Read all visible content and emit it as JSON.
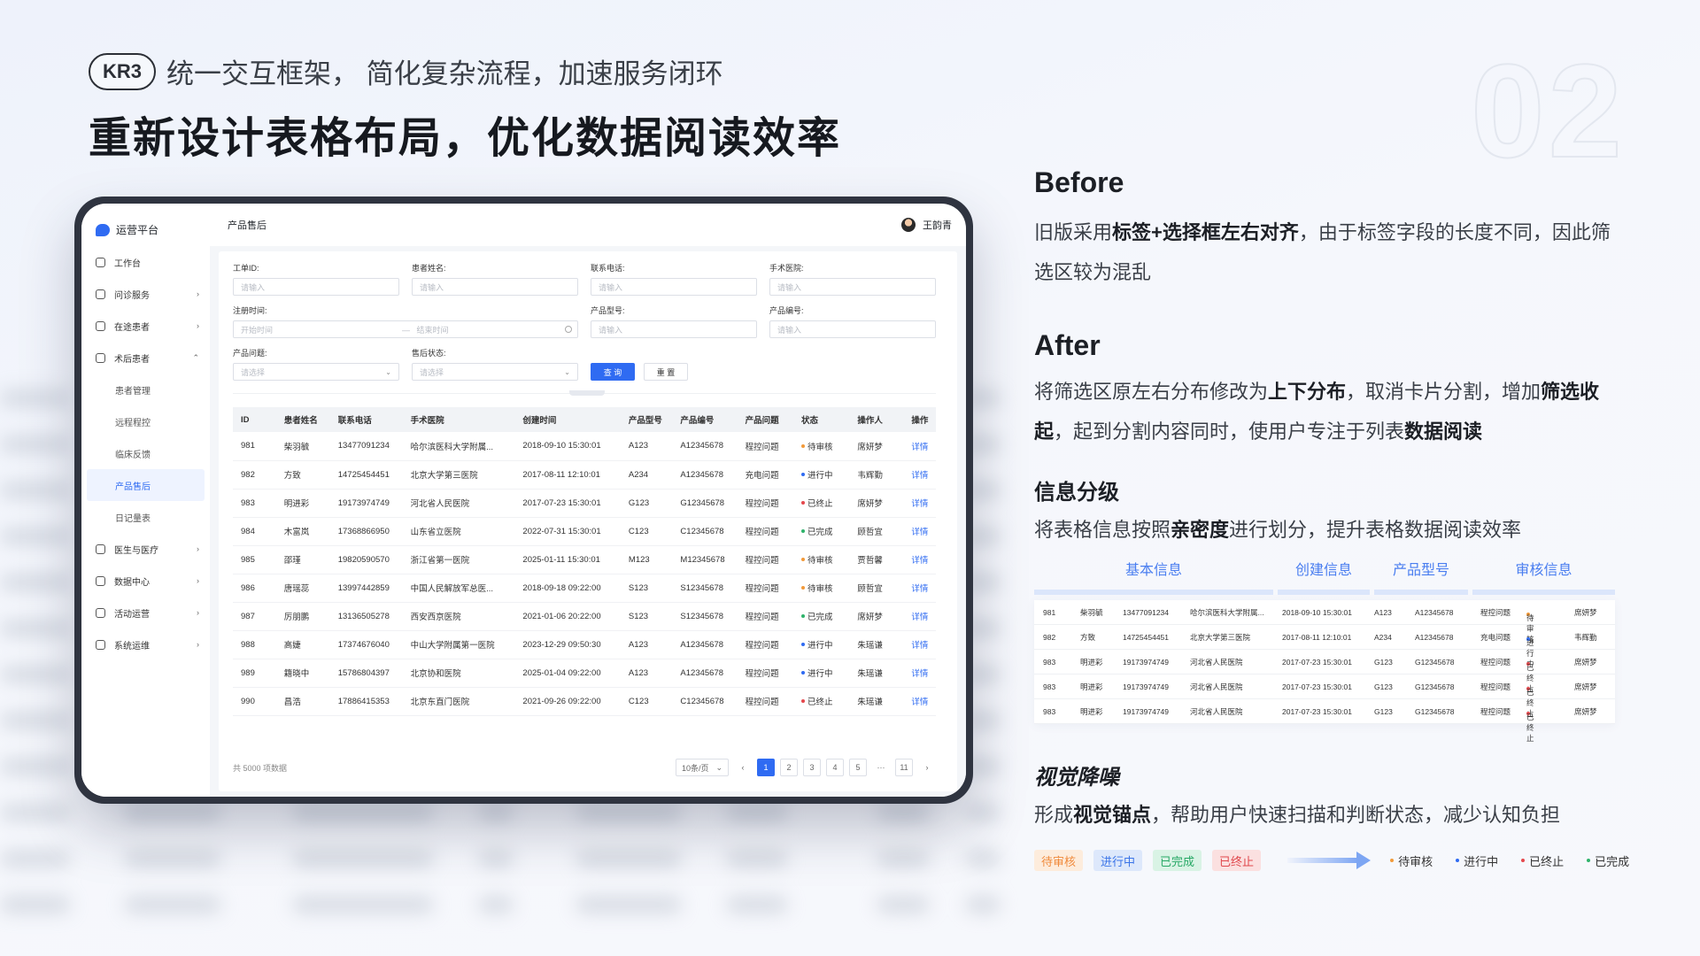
{
  "header": {
    "kr_badge": "KR3",
    "kr_text": "统一交互框架， 简化复杂流程，加速服务闭环",
    "title": "重新设计表格布局，优化数据阅读效率",
    "big_number": "02"
  },
  "app": {
    "logo_text": "运营平台",
    "page_title": "产品售后",
    "user_name": "王韵青",
    "nav": [
      {
        "label": "工作台",
        "icon": "home-icon",
        "arrow": ""
      },
      {
        "label": "问诊服务",
        "icon": "stethoscope-icon",
        "arrow": "›"
      },
      {
        "label": "在途患者",
        "icon": "user-icon",
        "arrow": "›"
      },
      {
        "label": "术后患者",
        "icon": "clipboard-icon",
        "arrow": "⌃"
      }
    ],
    "subnav": [
      "患者管理",
      "远程程控",
      "临床反馈",
      "产品售后",
      "日记量表"
    ],
    "nav_bottom": [
      {
        "label": "医生与医疗",
        "icon": "doctor-icon",
        "arrow": "›"
      },
      {
        "label": "数据中心",
        "icon": "data-icon",
        "arrow": "›"
      },
      {
        "label": "活动运营",
        "icon": "activity-icon",
        "arrow": "›"
      },
      {
        "label": "系统运维",
        "icon": "system-icon",
        "arrow": "›"
      }
    ],
    "filters": {
      "order_id_label": "工单ID:",
      "order_id_ph": "请输入",
      "patient_label": "患者姓名:",
      "patient_ph": "请输入",
      "phone_label": "联系电话:",
      "phone_ph": "请输入",
      "hospital_label": "手术医院:",
      "hospital_ph": "请输入",
      "reg_label": "注册时间:",
      "reg_start": "开始时间",
      "reg_sep": "—",
      "reg_end": "结束时间",
      "model_label": "产品型号:",
      "model_ph": "请输入",
      "code_label": "产品编号:",
      "code_ph": "请输入",
      "issue_label": "产品问题:",
      "issue_ph": "请选择",
      "aftersale_label": "售后状态:",
      "aftersale_ph": "请选择",
      "query_btn": "查 询",
      "reset_btn": "重 置"
    },
    "table": {
      "columns": [
        "ID",
        "患者姓名",
        "联系电话",
        "手术医院",
        "创建时间",
        "产品型号",
        "产品编号",
        "产品问题",
        "状态",
        "操作人",
        "操作"
      ],
      "rows": [
        {
          "id": "981",
          "name": "柴羽毓",
          "phone": "13477091234",
          "hospital": "哈尔滨医科大学附属...",
          "time": "2018-09-10 15:30:01",
          "model": "A123",
          "code": "A12345678",
          "issue": "程控问题",
          "status": "待审核",
          "status_color": "#f29a3a",
          "op": "席妍梦",
          "action": "详情"
        },
        {
          "id": "982",
          "name": "方致",
          "phone": "14725454451",
          "hospital": "北京大学第三医院",
          "time": "2017-08-11 12:10:01",
          "model": "A234",
          "code": "A12345678",
          "issue": "充电问题",
          "status": "进行中",
          "status_color": "#2f6bf2",
          "op": "韦辉勤",
          "action": "详情"
        },
        {
          "id": "983",
          "name": "明进彩",
          "phone": "19173974749",
          "hospital": "河北省人民医院",
          "time": "2017-07-23 15:30:01",
          "model": "G123",
          "code": "G12345678",
          "issue": "程控问题",
          "status": "已终止",
          "status_color": "#e5484d",
          "op": "席妍梦",
          "action": "详情"
        },
        {
          "id": "984",
          "name": "木富岚",
          "phone": "17368866950",
          "hospital": "山东省立医院",
          "time": "2022-07-31 15:30:01",
          "model": "C123",
          "code": "C12345678",
          "issue": "程控问题",
          "status": "已完成",
          "status_color": "#2fb36b",
          "op": "顾哲宜",
          "action": "详情"
        },
        {
          "id": "985",
          "name": "邵瑾",
          "phone": "19820590570",
          "hospital": "浙江省第一医院",
          "time": "2025-01-11 15:30:01",
          "model": "M123",
          "code": "M12345678",
          "issue": "程控问题",
          "status": "待审核",
          "status_color": "#f29a3a",
          "op": "贾哲馨",
          "action": "详情"
        },
        {
          "id": "986",
          "name": "唐瑶蕊",
          "phone": "13997442859",
          "hospital": "中国人民解放军总医...",
          "time": "2018-09-18 09:22:00",
          "model": "S123",
          "code": "S12345678",
          "issue": "程控问题",
          "status": "待审核",
          "status_color": "#f29a3a",
          "op": "顾哲宜",
          "action": "详情"
        },
        {
          "id": "987",
          "name": "厉朋鹏",
          "phone": "13136505278",
          "hospital": "西安西京医院",
          "time": "2021-01-06 20:22:00",
          "model": "S123",
          "code": "S12345678",
          "issue": "程控问题",
          "status": "已完成",
          "status_color": "#2fb36b",
          "op": "席妍梦",
          "action": "详情"
        },
        {
          "id": "988",
          "name": "高婕",
          "phone": "17374676040",
          "hospital": "中山大学附属第一医院",
          "time": "2023-12-29 09:50:30",
          "model": "A123",
          "code": "A12345678",
          "issue": "程控问题",
          "status": "进行中",
          "status_color": "#2f6bf2",
          "op": "朱瑶谦",
          "action": "详情"
        },
        {
          "id": "989",
          "name": "籍晓中",
          "phone": "15786804397",
          "hospital": "北京协和医院",
          "time": "2025-01-04 09:22:00",
          "model": "A123",
          "code": "A12345678",
          "issue": "程控问题",
          "status": "进行中",
          "status_color": "#2f6bf2",
          "op": "朱瑶谦",
          "action": "详情"
        },
        {
          "id": "990",
          "name": "昌浩",
          "phone": "17886415353",
          "hospital": "北京东直门医院",
          "time": "2021-09-26 09:22:00",
          "model": "C123",
          "code": "C12345678",
          "issue": "程控问题",
          "status": "已终止",
          "status_color": "#e5484d",
          "op": "朱瑶谦",
          "action": "详情"
        }
      ]
    },
    "footer": {
      "total": "共 5000 项数据",
      "page_size": "10条/页",
      "pages": [
        "1",
        "2",
        "3",
        "4",
        "5",
        "···",
        "11"
      ],
      "prev": "‹",
      "next": "›"
    }
  },
  "right": {
    "before_title": "Before",
    "before_text": [
      "旧版采用",
      "标签+选择框左右对齐",
      "，由于标签字段的长度不同，因此筛选区较为混乱"
    ],
    "after_title": "After",
    "after_text": [
      "将筛选区原左右分布修改为",
      "上下分布",
      "，取消卡片分割，增加",
      "筛选收起",
      "，起到分割内容同时，使用户专注于列表",
      "数据阅读"
    ],
    "level_title": "信息分级",
    "level_text": [
      "将表格信息按照",
      "亲密度",
      "进行划分，提升表格数据阅读效率"
    ],
    "mini_headers": [
      "基本信息",
      "创建信息",
      "产品型号",
      "审核信息"
    ],
    "mini_rows": [
      [
        "981",
        "柴羽毓",
        "13477091234",
        "哈尔滨医科大学附属...",
        "2018-09-10 15:30:01",
        "A123",
        "A12345678",
        "程控问题",
        "待审核",
        "席妍梦"
      ],
      [
        "982",
        "方致",
        "14725454451",
        "北京大学第三医院",
        "2017-08-11 12:10:01",
        "A234",
        "A12345678",
        "充电问题",
        "进行中",
        "韦辉勤"
      ],
      [
        "983",
        "明进彩",
        "19173974749",
        "河北省人民医院",
        "2017-07-23 15:30:01",
        "G123",
        "G12345678",
        "程控问题",
        "已终止",
        "席妍梦"
      ],
      [
        "983",
        "明进彩",
        "19173974749",
        "河北省人民医院",
        "2017-07-23 15:30:01",
        "G123",
        "G12345678",
        "程控问题",
        "已终止",
        "席妍梦"
      ],
      [
        "983",
        "明进彩",
        "19173974749",
        "河北省人民医院",
        "2017-07-23 15:30:01",
        "G123",
        "G12345678",
        "程控问题",
        "已终止",
        "席妍梦"
      ]
    ],
    "mini_status_colors": [
      "#f29a3a",
      "#2f6bf2",
      "#e5484d",
      "#e5484d",
      "#e5484d"
    ],
    "noise_title": "视觉降噪",
    "noise_text": [
      "形成",
      "视觉锚点",
      "，帮助用户快速扫描和判断状态，减少认知负担"
    ],
    "old_tags": [
      {
        "label": "待审核",
        "fg": "#f08a3c",
        "bg": "#fdecdc"
      },
      {
        "label": "进行中",
        "fg": "#3a74e8",
        "bg": "#dde8fb"
      },
      {
        "label": "已完成",
        "fg": "#26a865",
        "bg": "#d9f3e5"
      },
      {
        "label": "已终止",
        "fg": "#e0474c",
        "bg": "#fbe0e0"
      }
    ],
    "new_tags": [
      {
        "label": "待审核",
        "color": "#f29a3a"
      },
      {
        "label": "进行中",
        "color": "#2f6bf2"
      },
      {
        "label": "已终止",
        "color": "#e5484d"
      },
      {
        "label": "已完成",
        "color": "#2fb36b"
      }
    ]
  }
}
